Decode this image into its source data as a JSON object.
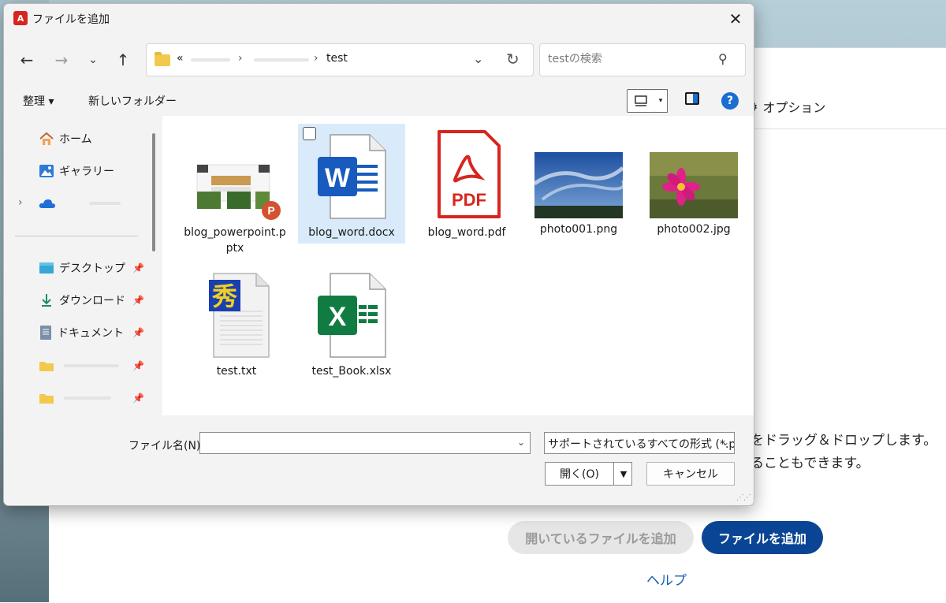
{
  "dialog": {
    "title": "ファイルを追加",
    "title_icon": "acrobat-icon"
  },
  "address": {
    "lead": "«",
    "current": "test"
  },
  "search": {
    "placeholder": "testの検索"
  },
  "toolbar": {
    "organize": "整理 ▾",
    "new_folder": "新しいフォルダー",
    "help": "?"
  },
  "sidebar": {
    "items": [
      {
        "label": "ホーム",
        "icon": "home-icon"
      },
      {
        "label": "ギャラリー",
        "icon": "gallery-icon"
      },
      {
        "label": "",
        "icon": "onedrive-icon"
      },
      {
        "label": "デスクトップ",
        "icon": "desktop-icon"
      },
      {
        "label": "ダウンロード",
        "icon": "download-icon"
      },
      {
        "label": "ドキュメント",
        "icon": "document-icon"
      },
      {
        "label": "",
        "icon": "folder-icon"
      },
      {
        "label": "",
        "icon": "folder-icon"
      }
    ]
  },
  "files": [
    {
      "name": "blog_powerpoint.pptx",
      "type": "pptx"
    },
    {
      "name": "blog_word.docx",
      "type": "docx",
      "selected": true
    },
    {
      "name": "blog_word.pdf",
      "type": "pdf"
    },
    {
      "name": "photo001.png",
      "type": "png"
    },
    {
      "name": "photo002.jpg",
      "type": "jpg"
    },
    {
      "name": "test.txt",
      "type": "txt"
    },
    {
      "name": "test_Book.xlsx",
      "type": "xlsx"
    }
  ],
  "bottom": {
    "filename_label": "ファイル名(N):",
    "filename_value": "",
    "filetype": "サポートされているすべての形式 (*.p",
    "open": "開く(O)",
    "cancel": "キャンセル"
  },
  "app": {
    "option": "オプション",
    "drop_line1": "をドラッグ＆ドロップします。",
    "drop_line2": "ることもできます。",
    "add_open_files": "開いているファイルを追加",
    "add_file": "ファイルを追加",
    "help": "ヘルプ"
  },
  "colors": {
    "accent": "#0a4595",
    "selection": "#d9ebfa",
    "pdf_red": "#d7261e",
    "word_blue": "#185abd",
    "excel_green": "#107c41"
  }
}
